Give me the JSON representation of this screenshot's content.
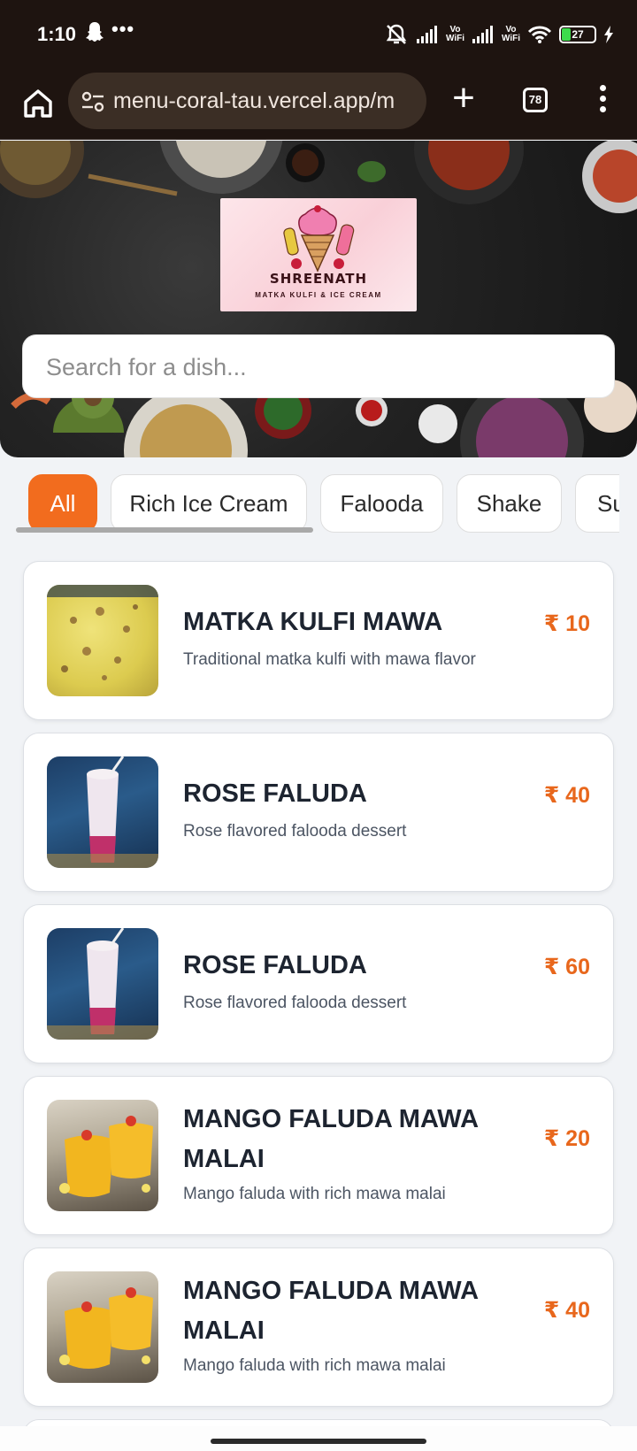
{
  "status_bar": {
    "time": "1:10",
    "more": "•••",
    "vowifi_1_top": "Vo",
    "vowifi_1_bottom": "WiFi",
    "vowifi_2_top": "Vo",
    "vowifi_2_bottom": "WiFi",
    "battery": "27",
    "icons": [
      "snapchat-icon",
      "mute-icon",
      "signal-icon",
      "wifi-icon",
      "battery-icon",
      "charging-icon"
    ]
  },
  "browser": {
    "url": "menu-coral-tau.vercel.app/m",
    "tab_count": "78",
    "new_tab": "+"
  },
  "hero": {
    "logo_title": "SHREENATH",
    "logo_subtitle": "MATKA KULFI & ICE CREAM"
  },
  "search": {
    "placeholder": "Search for a dish..."
  },
  "categories": [
    {
      "label": "All",
      "active": true
    },
    {
      "label": "Rich Ice Cream",
      "active": false
    },
    {
      "label": "Falooda",
      "active": false
    },
    {
      "label": "Shake",
      "active": false
    },
    {
      "label": "Su",
      "active": false
    }
  ],
  "items": [
    {
      "name": "MATKA KULFI MAWA",
      "description": "Traditional matka kulfi with mawa flavor",
      "price": "₹ 10"
    },
    {
      "name": "ROSE FALUDA",
      "description": "Rose flavored falooda dessert",
      "price": "₹ 40"
    },
    {
      "name": "ROSE FALUDA",
      "description": "Rose flavored falooda dessert",
      "price": "₹ 60"
    },
    {
      "name": "MANGO FALUDA MAWA MALAI",
      "description": "Mango faluda with rich mawa malai",
      "price": "₹ 20"
    },
    {
      "name": "MANGO FALUDA MAWA MALAI",
      "description": "Mango faluda with rich mawa malai",
      "price": "₹ 40"
    }
  ],
  "colors": {
    "accent": "#f26c1e",
    "price": "#e8671c",
    "browser_bg": "#1e1410"
  }
}
